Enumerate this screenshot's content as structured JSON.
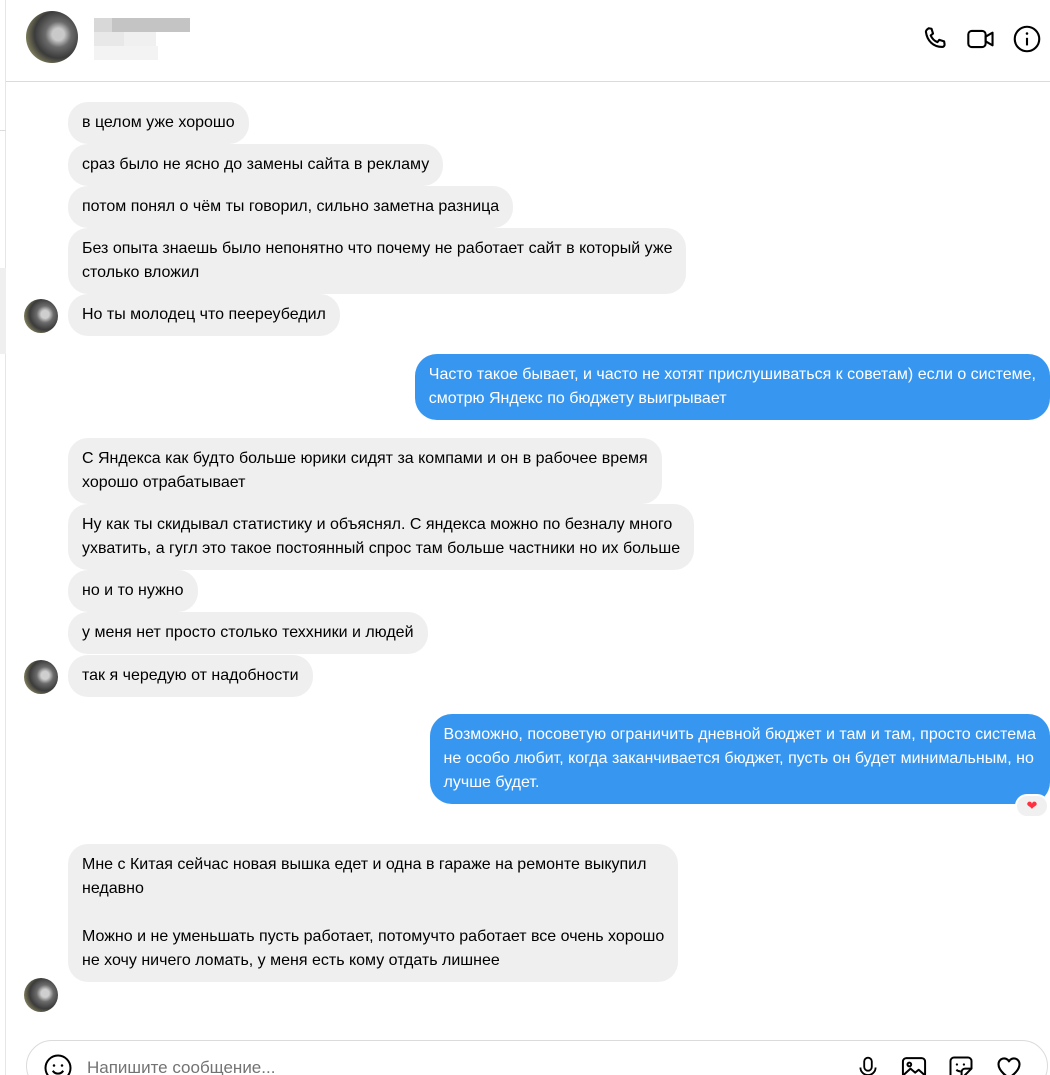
{
  "header": {
    "contact_name_blurred": "",
    "icons": [
      "phone-icon",
      "video-camera-icon",
      "info-icon"
    ]
  },
  "messages": [
    {
      "dir": "in",
      "text": "в целом уже хорошо"
    },
    {
      "dir": "in",
      "text": "сраз было не ясно до замены сайта в рекламу"
    },
    {
      "dir": "in",
      "text": "потом понял о чём ты говорил, сильно заметна разница"
    },
    {
      "dir": "in",
      "text": "Без опыта знаешь было непонятно что почему не работает сайт в который уже\nстолько вложил"
    },
    {
      "dir": "in",
      "text": "Но ты молодец что пееreубедил"
    },
    {
      "dir": "out",
      "text": "Часто такое бывает, и часто не хотят прислушиваться к советам) если о системе,\nсмотрю Яндекс по бюджету выигрывает"
    },
    {
      "dir": "in",
      "text": "С Яндекса как будто больше юрики сидят за компами и он в рабочее время\nхорошо отрабатывает"
    },
    {
      "dir": "in",
      "text": "Ну как ты скидывал статистику и объяснял. С яндекса можно по безналу много\nухватить, а гугл это такое постоянный спрос там больше частники но их больше"
    },
    {
      "dir": "in",
      "text": "но и то нужно"
    },
    {
      "dir": "in",
      "text": "у меня нет просто столько теххники и людей"
    },
    {
      "dir": "in",
      "text": "так я чередую от надобности"
    },
    {
      "dir": "out",
      "text": "Возможно, посоветую ограничить дневной бюджет и там и там, просто система\nне особо любит, когда заканчивается бюджет, пусть он будет минимальным, но\nлучше будет."
    },
    {
      "dir": "in",
      "text": "Мне с Китая сейчас новая вышка едет и одна в гараже на ремонте выкупил\nнедавно\n\nМожно и не уменьшать пусть работает, потомучто работает все очень хорошо\nне хочу ничего ломать, у меня есть кому отдать лишнее"
    }
  ],
  "reaction": {
    "emoji": "❤",
    "color": "#ff3040"
  },
  "composer": {
    "placeholder": "Напишите сообщение...",
    "icons": [
      "emoji-icon",
      "microphone-icon",
      "image-icon",
      "sticker-icon",
      "heart-icon"
    ]
  },
  "colors": {
    "outgoing_bubble": "#3797f0",
    "incoming_bubble": "#efefef"
  }
}
